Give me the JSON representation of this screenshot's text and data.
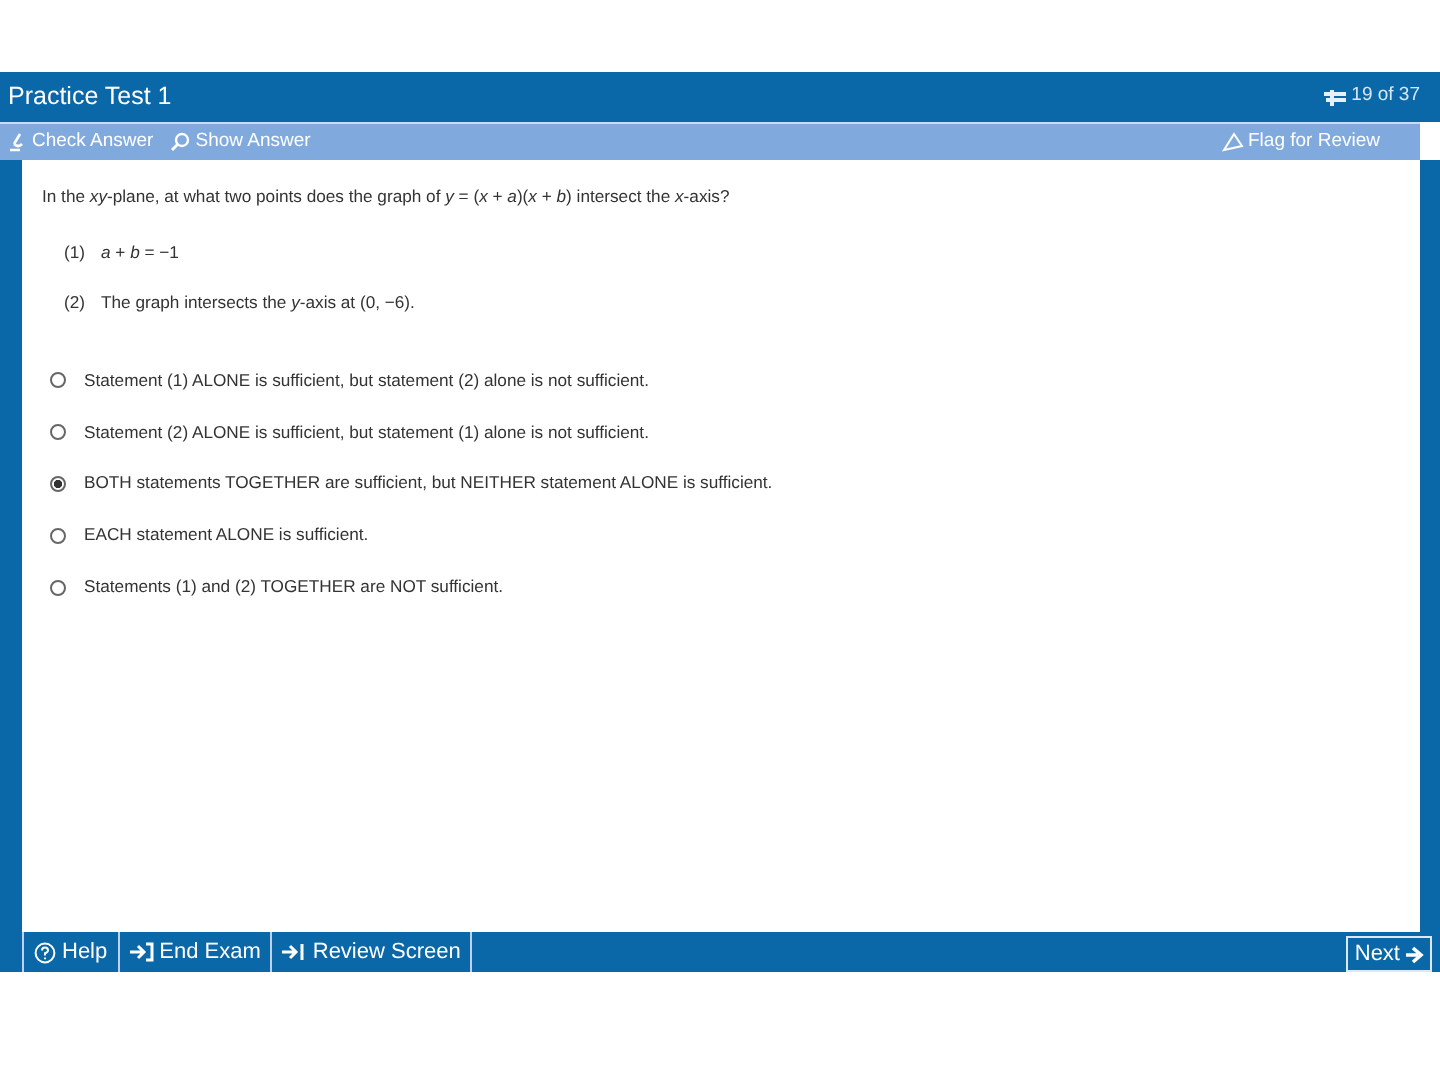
{
  "window": {
    "title": "Practice Test 1",
    "counter": "19 of 37"
  },
  "toolbar": {
    "left": [
      {
        "label": "Check Answer",
        "kind": "check"
      },
      {
        "label": "Show Answer",
        "kind": "show"
      }
    ],
    "right": {
      "label": "Flag for Review",
      "kind": "flag"
    }
  },
  "question": "In the *xy*-plane, at what two points does the graph of *y* = (*x* + *a*)(*x* + *b*) intersect the *x*-axis?",
  "statements": [
    {
      "number": "(1)",
      "text": "*a* + *b* = −1"
    },
    {
      "number": "(2)",
      "text": "The graph intersects the *y*-axis at (0, −6)."
    }
  ],
  "choices": [
    {
      "text": "Statement (1) ALONE is sufficient, but statement (2) alone is not sufficient.",
      "selected": false
    },
    {
      "text": "Statement (2) ALONE is sufficient, but statement (1) alone is not sufficient.",
      "selected": false
    },
    {
      "text": "BOTH statements TOGETHER are sufficient, but NEITHER statement ALONE is sufficient.",
      "selected": true
    },
    {
      "text": "EACH statement ALONE is sufficient.",
      "selected": false
    },
    {
      "text": "Statements (1) and (2) TOGETHER are NOT sufficient.",
      "selected": false
    }
  ],
  "bottom_bar": {
    "buttons": [
      {
        "label": "Help",
        "kind": "help"
      },
      {
        "label": "End Exam",
        "kind": "end"
      },
      {
        "label": "Review Screen",
        "kind": "review"
      }
    ],
    "next": "Next"
  }
}
